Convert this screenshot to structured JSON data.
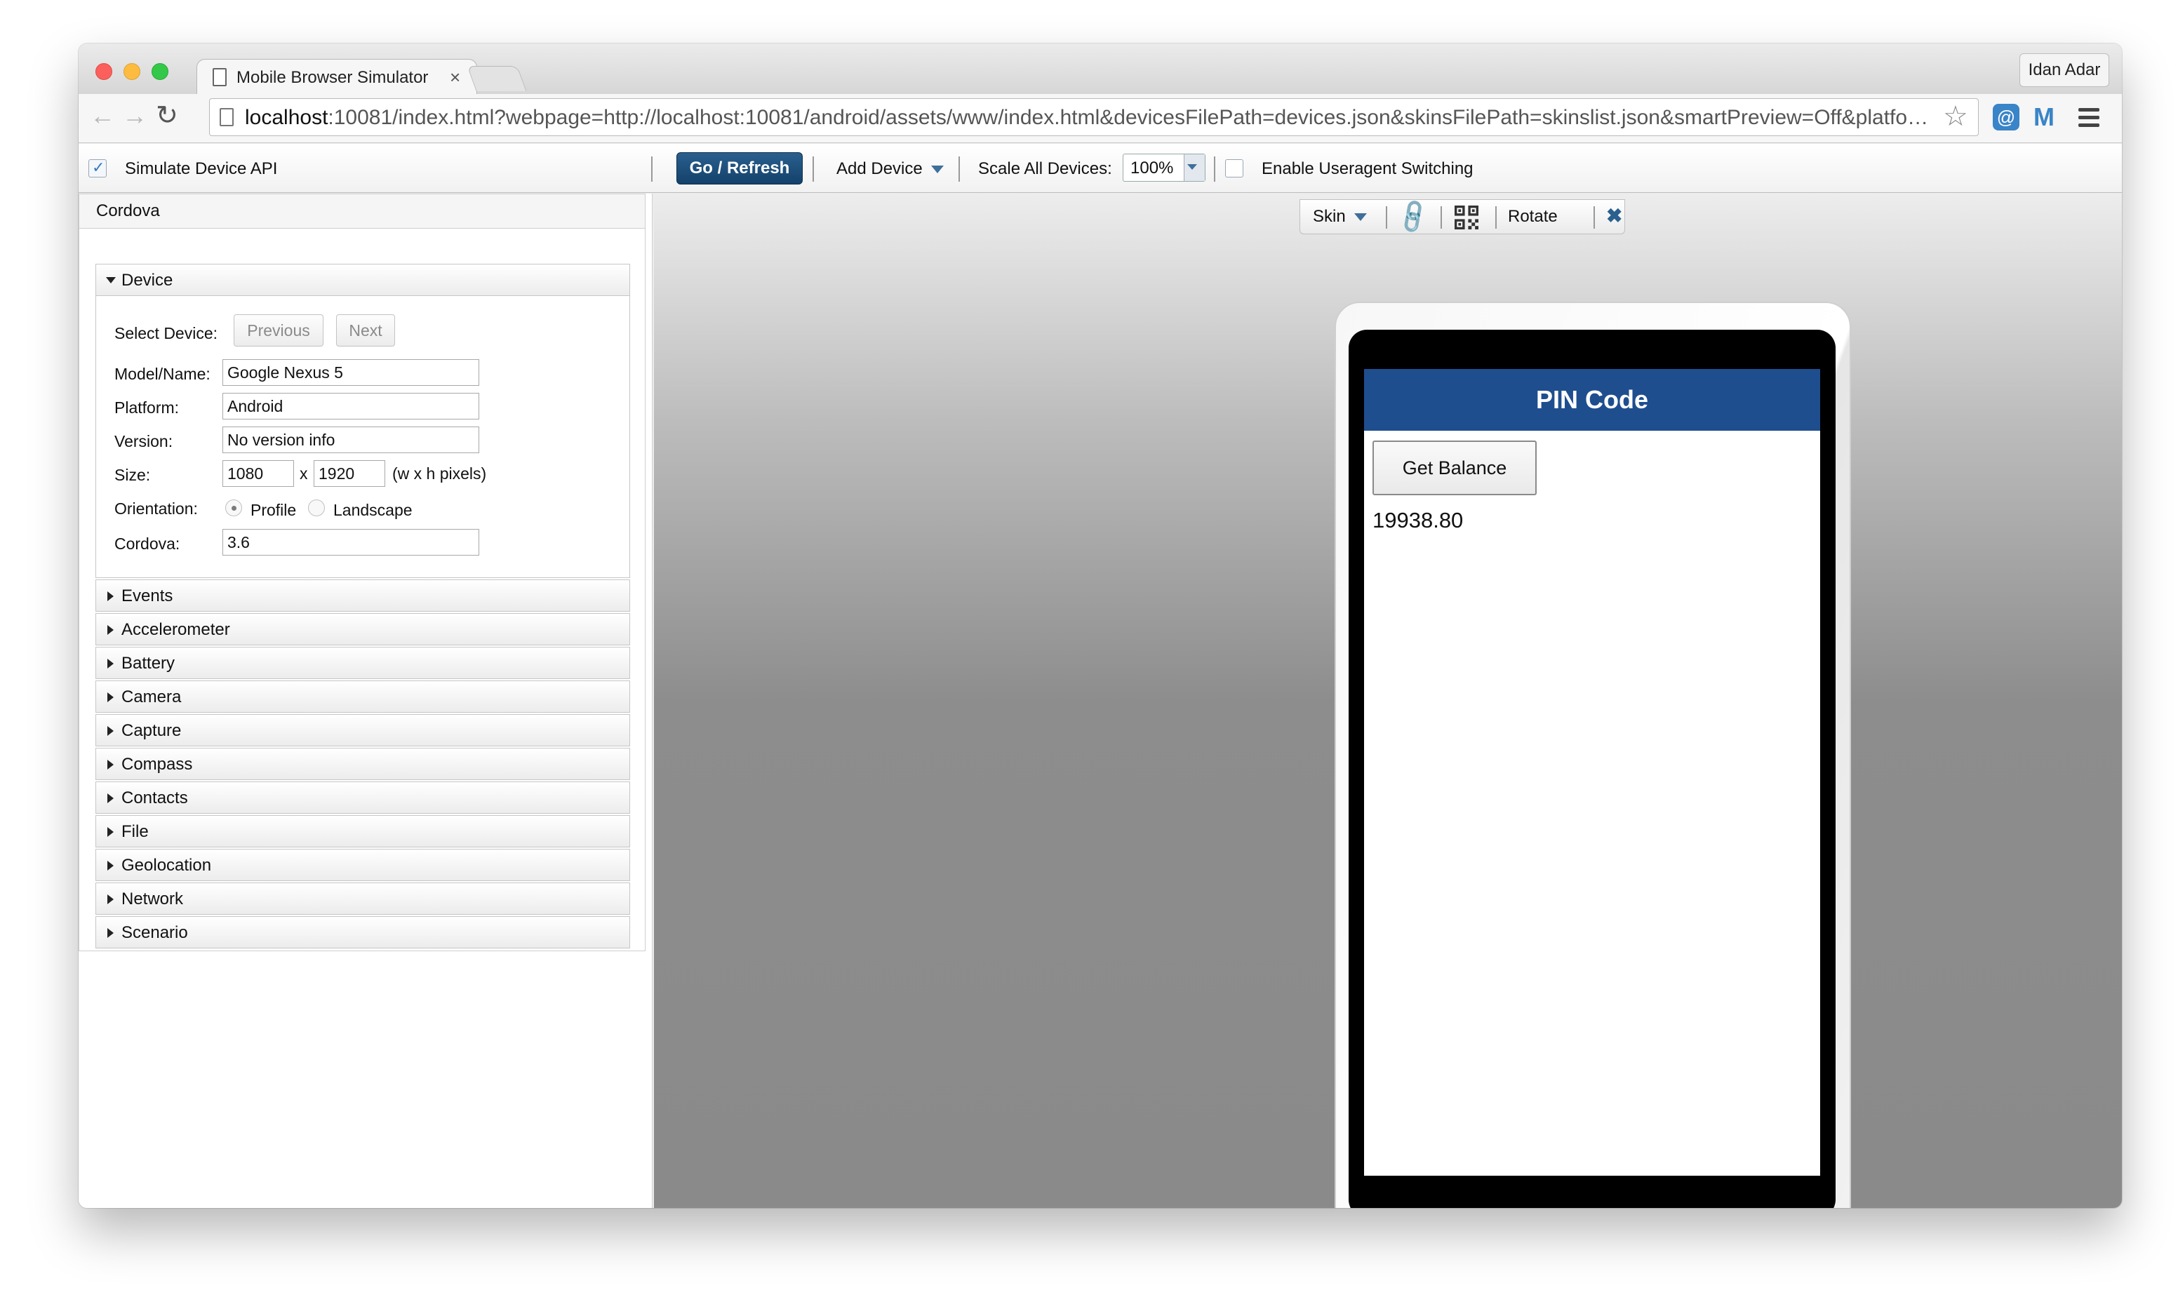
{
  "browser": {
    "tab_title": "Mobile Browser Simulator",
    "tab_close": "×",
    "profile_name": "Idan Adar",
    "address_host": "localhost",
    "address_rest": ":10081/index.html?webpage=http://localhost:10081/android/assets/www/index.html&devicesFilePath=devices.json&skinsFilePath=skinslist.json&smartPreview=Off&platfor...",
    "back_glyph": "←",
    "forward_glyph": "→",
    "reload_glyph": "↻",
    "star_glyph": "☆",
    "ext1_glyph": "@",
    "ext2_glyph": "M"
  },
  "toolbar": {
    "simulate_label": "Simulate Device API",
    "simulate_checked": true,
    "check_glyph": "✓",
    "go_label": "Go / Refresh",
    "add_device_label": "Add Device",
    "scale_label": "Scale All Devices:",
    "scale_value": "100%",
    "ua_label": "Enable Useragent Switching",
    "ua_checked": false
  },
  "panel": {
    "title": "Cordova",
    "device": {
      "section_label": "Device",
      "select_label": "Select Device:",
      "previous_label": "Previous",
      "next_label": "Next",
      "model_label": "Model/Name:",
      "model_value": "Google Nexus 5",
      "platform_label": "Platform:",
      "platform_value": "Android",
      "version_label": "Version:",
      "version_value": "No version info",
      "size_label": "Size:",
      "width_value": "1080",
      "size_x": "x",
      "height_value": "1920",
      "size_unit": "(w x h pixels)",
      "orientation_label": "Orientation:",
      "profile_label": "Profile",
      "landscape_label": "Landscape",
      "cordova_label": "Cordova:",
      "cordova_value": "3.6"
    },
    "sections": [
      "Events",
      "Accelerometer",
      "Battery",
      "Camera",
      "Capture",
      "Compass",
      "Contacts",
      "File",
      "Geolocation",
      "Network",
      "Scenario"
    ]
  },
  "device_toolbar": {
    "skin_label": "Skin",
    "link_glyph": "🔗",
    "rotate_label": "Rotate",
    "close_glyph": "✖"
  },
  "app": {
    "header_title": "PIN Code",
    "button_label": "Get Balance",
    "balance": "19938.80"
  }
}
